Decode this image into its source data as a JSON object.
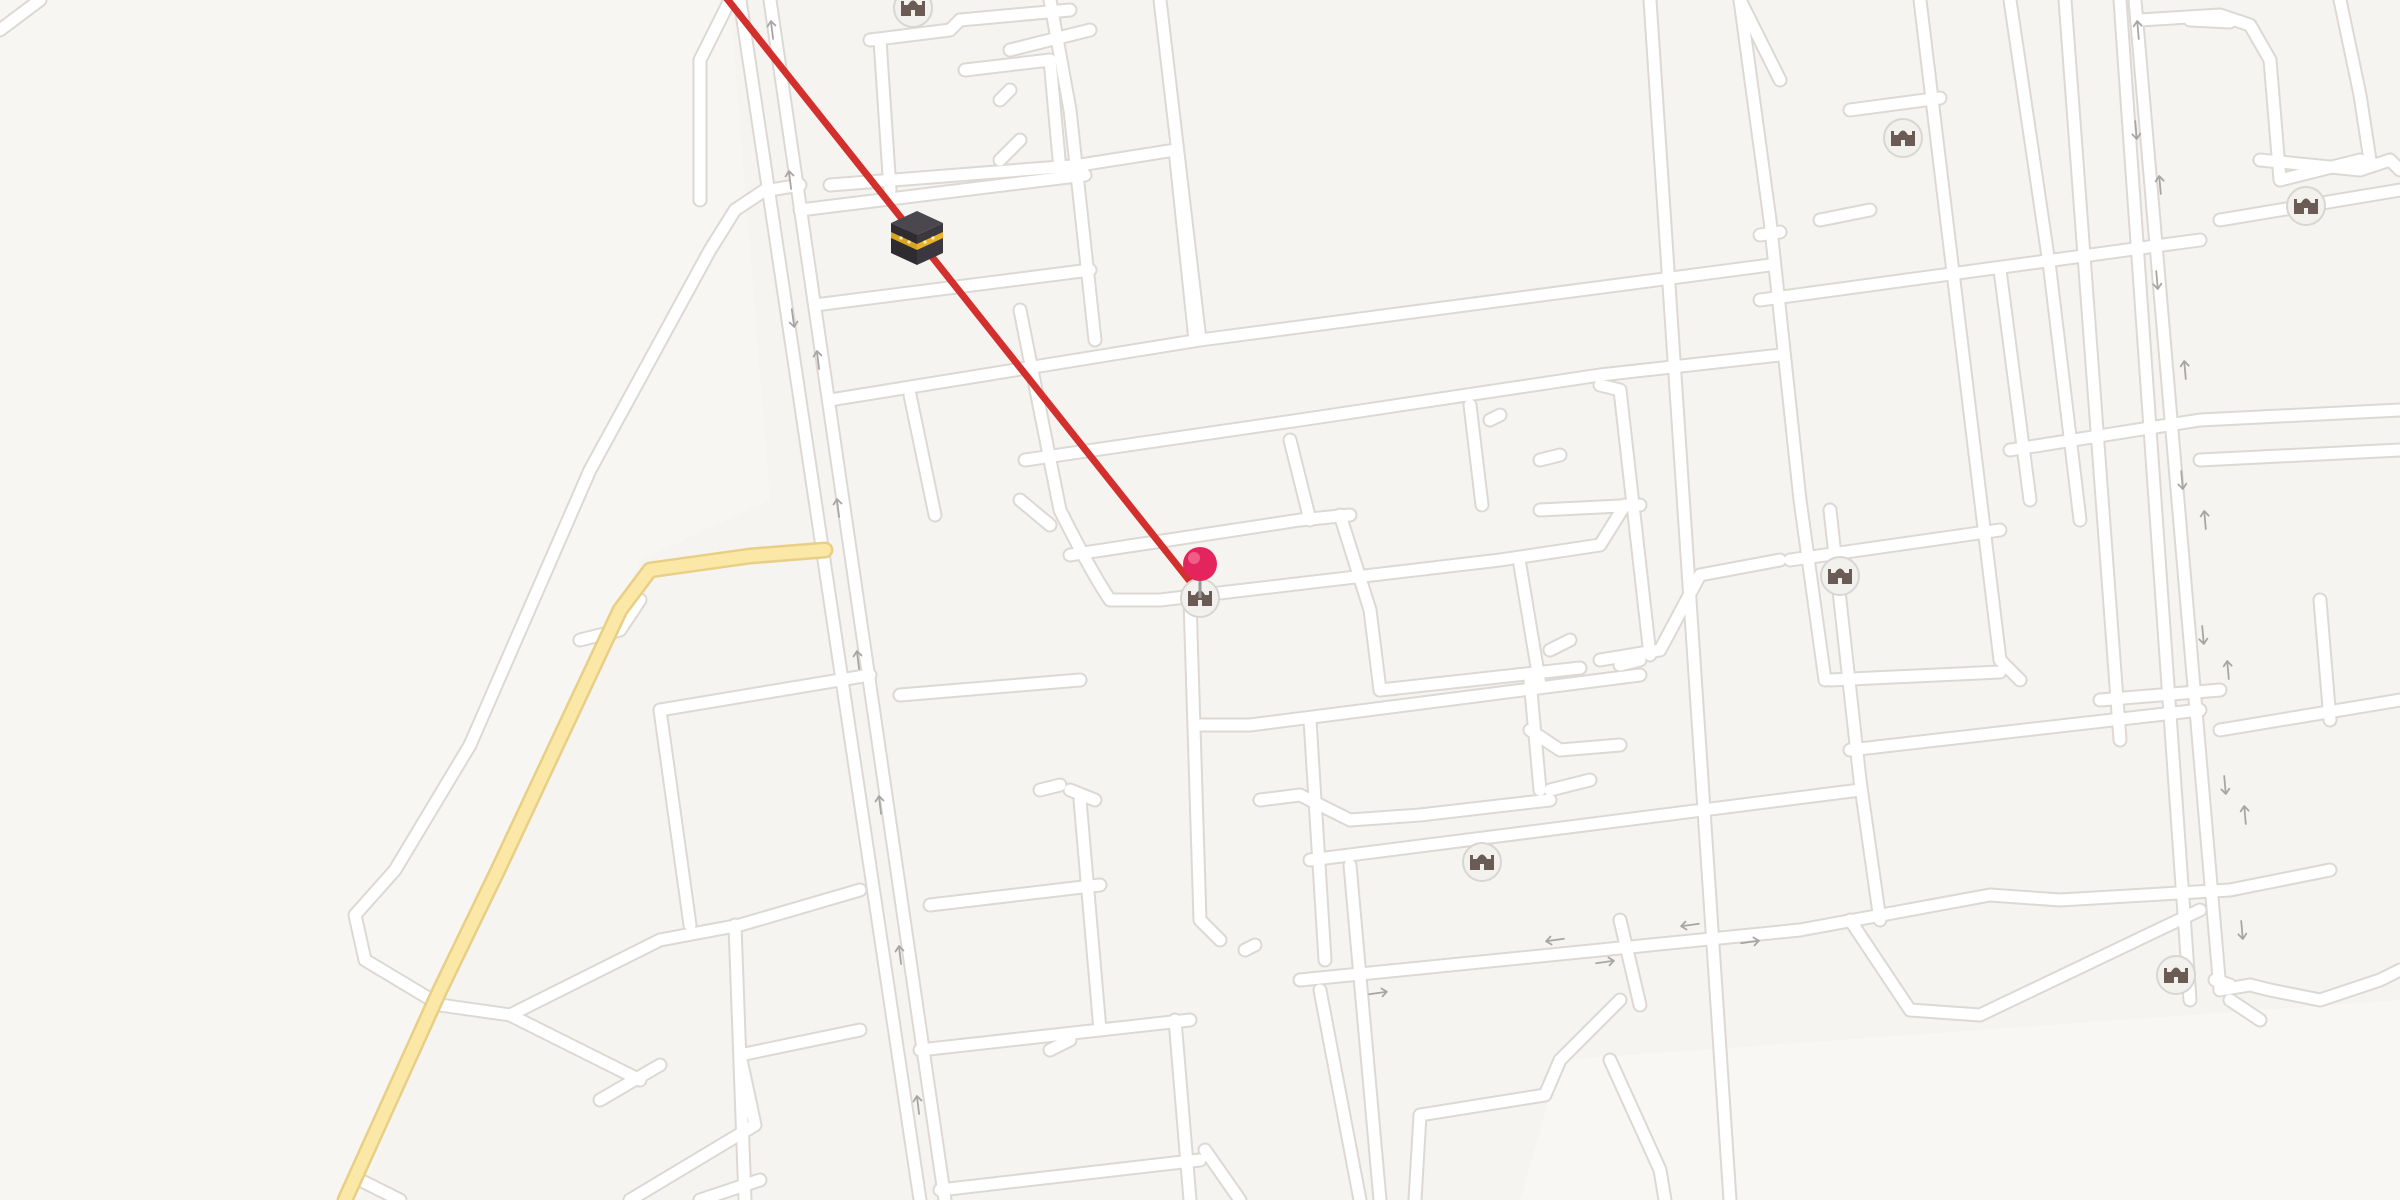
{
  "map": {
    "view": "qibla-direction-map",
    "colors": {
      "background": "#f6f4f1",
      "road": "#ffffff",
      "road_outline": "#dcd9d4",
      "major_road": "#fbe7a6",
      "qibla_line": "#d3302d",
      "location_pin": "#e4245d",
      "kaaba_body": "#2e2c31",
      "kaaba_band": "#d9a520"
    },
    "kaaba_marker": {
      "icon": "kaaba-icon"
    },
    "location_marker": {
      "icon": "map-pin-icon"
    },
    "poi_icon": "mosque-icon",
    "poi_count": 7
  }
}
